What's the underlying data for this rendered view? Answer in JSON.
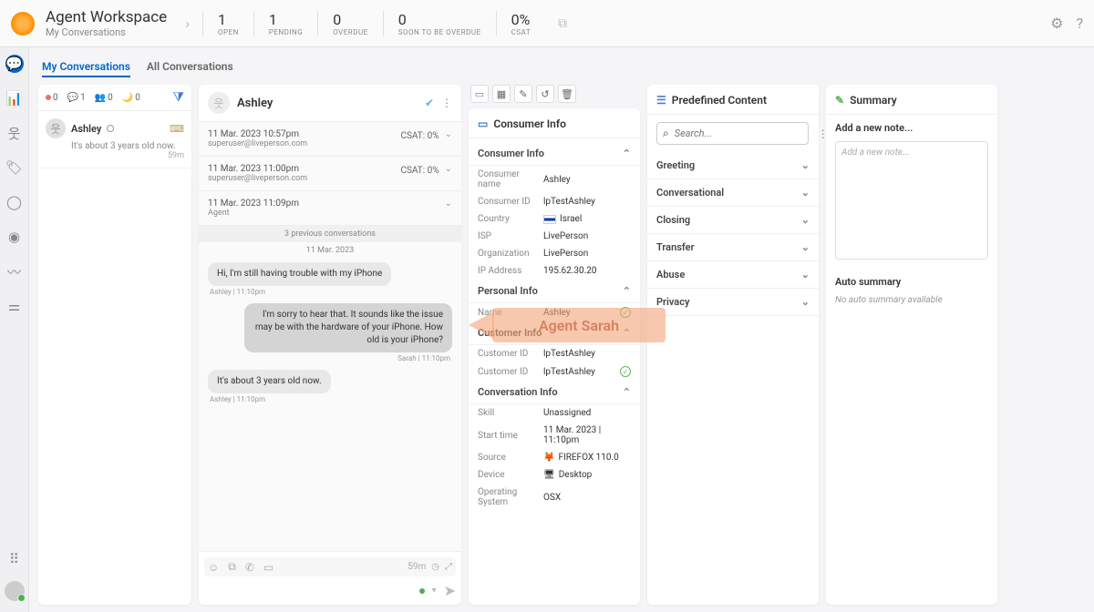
{
  "header": {
    "title": "Agent Workspace",
    "subtitle": "My Conversations",
    "stats": [
      {
        "value": "1",
        "label": "OPEN"
      },
      {
        "value": "1",
        "label": "PENDING"
      },
      {
        "value": "0",
        "label": "OVERDUE"
      },
      {
        "value": "0",
        "label": "SOON TO BE OVERDUE"
      },
      {
        "value": "0%",
        "label": "CSAT"
      }
    ]
  },
  "tabs": {
    "my": "My Conversations",
    "all": "All Conversations"
  },
  "convlist": {
    "counters": [
      {
        "color": "#e57373",
        "n": "0"
      },
      {
        "color": "#64b5f6",
        "n": "1"
      },
      {
        "color": "#ba68c8",
        "n": "0"
      },
      {
        "color": "#4db6ac",
        "n": "0"
      }
    ],
    "item": {
      "name": "Ashley",
      "preview": "It's about 3 years old now.",
      "time": "59m"
    }
  },
  "chat": {
    "name": "Ashley",
    "history": [
      {
        "l1": "11 Mar. 2023 10:57pm",
        "l2": "superuser@liveperson.com",
        "csat": "CSAT: 0%"
      },
      {
        "l1": "11 Mar. 2023 11:00pm",
        "l2": "superuser@liveperson.com",
        "csat": "CSAT: 0%"
      },
      {
        "l1": "11 Mar. 2023 11:09pm",
        "l2": "Agent",
        "csat": ""
      }
    ],
    "divider": "3 previous conversations",
    "date": "11 Mar. 2023",
    "messages": [
      {
        "side": "in",
        "text": "Hi, I'm still having trouble with my iPhone",
        "meta": "Ashley  |  11:10pm"
      },
      {
        "side": "out",
        "text": "I'm sorry to hear that. It sounds like the issue may be with the hardware of your iPhone. How old is your iPhone?",
        "meta": "Sarah  |  11:10pm"
      },
      {
        "side": "in",
        "text": "It's about 3 years old now.",
        "meta": "Ashley  |  11:10pm"
      }
    ],
    "timer": "59m"
  },
  "consumer": {
    "title": "Consumer Info",
    "sections": {
      "consumer_info": {
        "title": "Consumer Info",
        "rows": [
          {
            "k": "Consumer name",
            "v": "Ashley"
          },
          {
            "k": "Consumer ID",
            "v": "lpTestAshley"
          },
          {
            "k": "Country",
            "v": "Israel",
            "flag": true
          },
          {
            "k": "ISP",
            "v": "LivePerson"
          },
          {
            "k": "Organization",
            "v": "LivePerson"
          },
          {
            "k": "IP Address",
            "v": "195.62.30.20"
          }
        ]
      },
      "personal": {
        "title": "Personal Info",
        "rows": [
          {
            "k": "Name",
            "v": "Ashley",
            "check": true
          }
        ]
      },
      "customer": {
        "title": "Customer Info",
        "rows": [
          {
            "k": "Customer ID",
            "v": "lpTestAshley"
          },
          {
            "k": "Customer ID",
            "v": "lpTestAshley",
            "check": true
          }
        ]
      },
      "conversation": {
        "title": "Conversation Info",
        "rows": [
          {
            "k": "Skill",
            "v": "Unassigned"
          },
          {
            "k": "Start time",
            "v": "11 Mar. 2023 | 11:10pm"
          },
          {
            "k": "Source",
            "v": "FIREFOX 110.0",
            "browser": true
          },
          {
            "k": "Device",
            "v": "Desktop",
            "device": true
          },
          {
            "k": "Operating System",
            "v": "OSX"
          }
        ]
      }
    }
  },
  "predefined": {
    "title": "Predefined Content",
    "search_placeholder": "Search...",
    "items": [
      "Greeting",
      "Conversational",
      "Closing",
      "Transfer",
      "Abuse",
      "Privacy"
    ]
  },
  "summary": {
    "title": "Summary",
    "add": "Add a new note...",
    "placeholder": "Add a new note...",
    "auto_title": "Auto summary",
    "auto_text": "No auto summary available"
  },
  "annotation": "Agent Sarah"
}
